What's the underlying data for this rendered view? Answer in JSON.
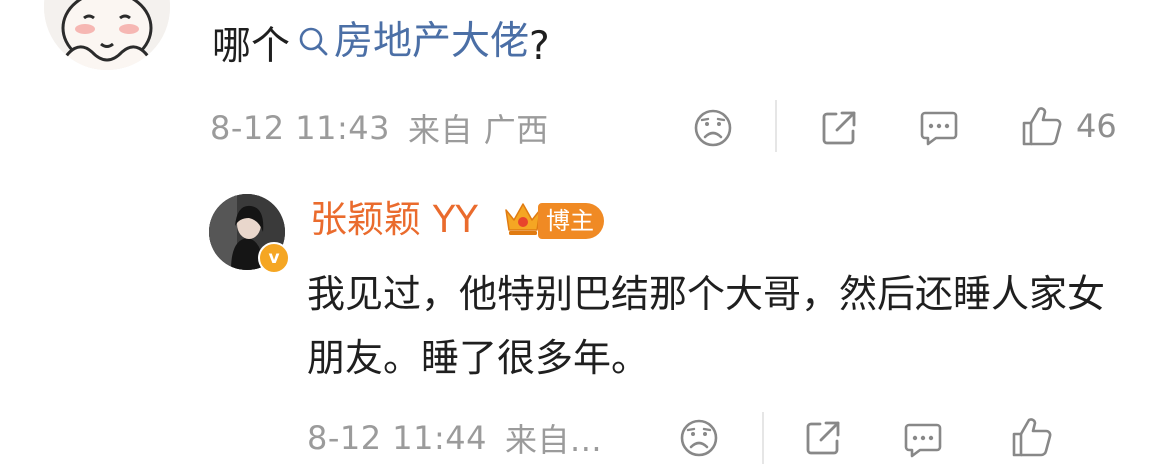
{
  "comment": {
    "text_before": "哪个",
    "topic": "房地产大佬",
    "text_after": "?",
    "time": "8-12 11:43",
    "location": "来自 广西",
    "like_count": "46"
  },
  "reply": {
    "name": "张颖颖 YY",
    "badge": "博主",
    "verified": "v",
    "text": "我见过，他特别巴结那个大哥，然后还睡人家女朋友。睡了很多年。",
    "time": "8-12 11:44",
    "location": "来自..."
  },
  "colors": {
    "link": "#4b6fa6",
    "name": "#ea6b2d",
    "badge": "#f08a24",
    "meta": "#9b9b9b"
  },
  "icons": [
    "sad-face-icon",
    "share-icon",
    "comment-icon",
    "like-icon",
    "crown-icon",
    "search-icon"
  ]
}
